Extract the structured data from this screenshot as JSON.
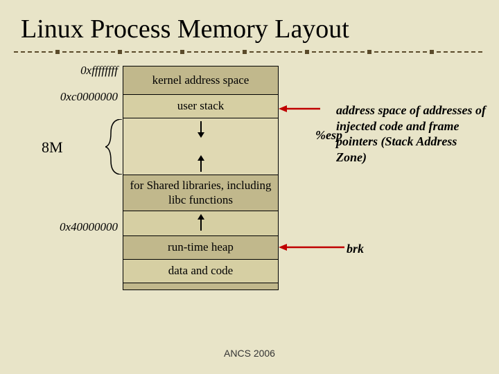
{
  "title": "Linux Process Memory Layout",
  "addresses": {
    "top": "0xffffffff",
    "kernel": "0xc0000000",
    "eightM": "8M",
    "libs": "0x40000000"
  },
  "segments": {
    "kernel": "kernel address space",
    "stack": "user stack",
    "libs": "for Shared libraries, including libc functions",
    "heap": "run-time heap",
    "datacode": "data and code"
  },
  "annotations": {
    "stack_zone": "address space of addresses of injected code and frame pointers (Stack Address Zone)",
    "esp": "%esp",
    "brk": "brk"
  },
  "footer": "ANCS 2006"
}
